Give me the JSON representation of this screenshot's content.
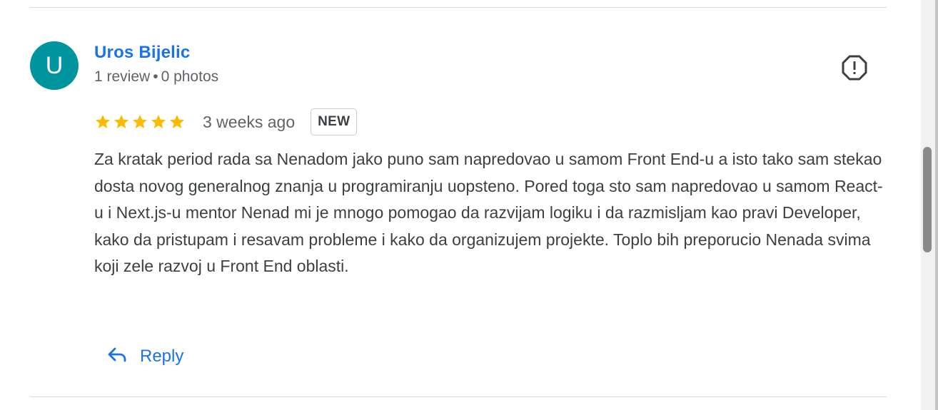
{
  "review": {
    "author": {
      "initial": "U",
      "name": "Uros Bijelic",
      "reviews_count": "1 review",
      "separator": "•",
      "photos_count": "0 photos",
      "avatar_color": "#00959e"
    },
    "rating": {
      "stars": 5,
      "max_stars": 5,
      "star_color": "#fbbc04"
    },
    "time_ago": "3 weeks ago",
    "badge": "NEW",
    "text": "Za kratak period rada sa Nenadom jako puno sam napredovao u samom Front End-u a isto tako sam stekao dosta novog generalnog znanja u programiranju uopsteno. Pored toga sto sam napredovao u samom React-u i Next.js-u mentor Nenad mi je mnogo pomogao da razvijam logiku i da razmisljam kao pravi Developer, kako da pristupam i resavam probleme i kako da organizujem projekte. Toplo bih preporucio Nenada svima koji zele razvoj u Front End oblasti.",
    "reply_label": "Reply",
    "icons": {
      "report": "report-icon",
      "reply": "reply-arrow-icon",
      "star": "star-icon"
    }
  },
  "theme": {
    "link_color": "#1a73e8",
    "text_color": "#3c4043",
    "muted_color": "#5f6368"
  }
}
